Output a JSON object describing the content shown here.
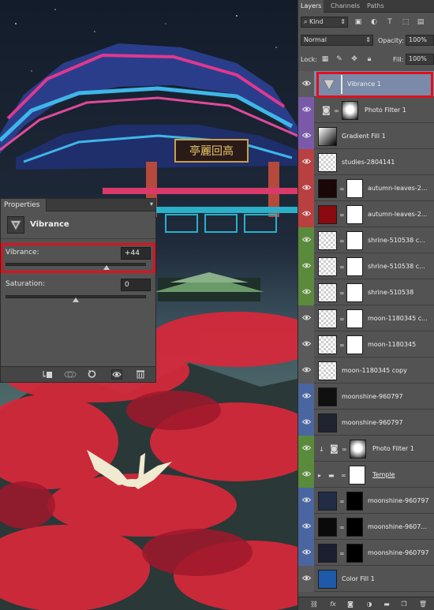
{
  "properties_panel": {
    "tab_label": "Properties",
    "menu_icon": "panel-menu-icon",
    "adjustment_title": "Vibrance",
    "vibrance": {
      "label": "Vibrance:",
      "value": "+44",
      "slider_fraction": 0.72
    },
    "saturation": {
      "label": "Saturation:",
      "value": "0",
      "slider_fraction": 0.5
    },
    "footer_icons": [
      "clip-to-layer-icon",
      "view-previous-state-icon",
      "reset-icon",
      "visibility-eye-icon",
      "trash-icon"
    ]
  },
  "layers_panel": {
    "tabs": [
      {
        "label": "Layers",
        "active": true
      },
      {
        "label": "Channels",
        "active": false
      },
      {
        "label": "Paths",
        "active": false
      }
    ],
    "filter_kind": "Kind",
    "blend_mode": "Normal",
    "opacity_label": "Opacity:",
    "opacity_value": "100%",
    "lock_label": "Lock:",
    "fill_label": "Fill:",
    "fill_value": "100%",
    "layers": [
      {
        "name": "Vibrance 1",
        "type": "adjustment-vibrance",
        "color": "#5a5a5a",
        "selected": true
      },
      {
        "name": "Photo Filter 1",
        "type": "adjustment-photo-filter",
        "color": "#7a5aa8"
      },
      {
        "name": "Gradient Fill 1",
        "type": "gradient-fill",
        "color": "#7a5aa8"
      },
      {
        "name": "studies-2804141",
        "type": "pixel",
        "color": "#b84040"
      },
      {
        "name": "autumn-leaves-2...",
        "type": "pixel-mask",
        "color": "#b84040"
      },
      {
        "name": "autumn-leaves-2...",
        "type": "pixel-mask",
        "color": "#b84040"
      },
      {
        "name": "shrine-510538 c...",
        "type": "pixel-mask",
        "color": "#5a8a3c"
      },
      {
        "name": "shrine-510538 c...",
        "type": "pixel-mask",
        "color": "#5a8a3c"
      },
      {
        "name": "shrine-510538",
        "type": "pixel-mask",
        "color": "#5a8a3c"
      },
      {
        "name": "moon-1180345 c...",
        "type": "pixel-mask",
        "color": "#5a5a5a"
      },
      {
        "name": "moon-1180345",
        "type": "pixel-mask",
        "color": "#5a5a5a"
      },
      {
        "name": "moon-1180345 copy",
        "type": "pixel",
        "color": "#5a5a5a"
      },
      {
        "name": "moonshine-960797",
        "type": "pixel",
        "color": "#4a66a0"
      },
      {
        "name": "moonshine-960797",
        "type": "pixel",
        "color": "#4a66a0"
      },
      {
        "name": "Photo Filter 1",
        "type": "adjustment-photo-filter",
        "color": "#5a8a3c"
      },
      {
        "name": "Temple",
        "type": "group",
        "color": "#5a8a3c"
      },
      {
        "name": "moonshine-960797",
        "type": "pixel-mask",
        "color": "#4a66a0"
      },
      {
        "name": "moonshine-9607...",
        "type": "pixel-mask",
        "color": "#4a66a0"
      },
      {
        "name": "moonshine-960797",
        "type": "pixel-mask",
        "color": "#4a66a0"
      },
      {
        "name": "Color Fill 1",
        "type": "color-fill",
        "color": "#5a5a5a"
      }
    ],
    "bottom_icons": [
      "link-layers-icon",
      "fx-icon",
      "add-mask-icon",
      "new-adjustment-icon",
      "new-group-icon",
      "new-layer-icon",
      "delete-layer-icon"
    ]
  },
  "canvas": {
    "sign_text": "亭麗回高",
    "colors": {
      "sky": "#1c2533",
      "roof_blue": "#3fb6e8",
      "roof_magenta": "#e0388f",
      "leaves_red": "#d8283a",
      "highlight_red": "#e0101d"
    }
  }
}
